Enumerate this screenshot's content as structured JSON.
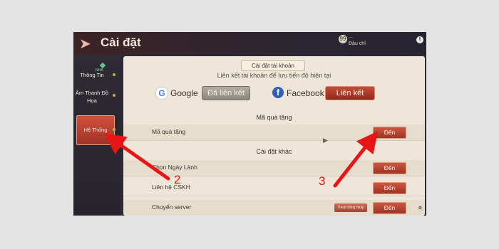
{
  "header": {
    "back_icon": "back-arrow-icon",
    "title": "Cài đặt",
    "level": "99",
    "user_meta": "...",
    "user_name": "Đậu chí"
  },
  "sidebar": {
    "items": [
      {
        "label": "Thông Tin"
      },
      {
        "label": "Âm Thanh Đồ Họa"
      },
      {
        "label": "Hệ Thống",
        "active": true
      }
    ],
    "gem_label": "NHA"
  },
  "account": {
    "section_title": "Cài đặt tài khoản",
    "description": "Liên kết tài khoản để lưu tiến độ hiện tại",
    "google": {
      "logo": "G",
      "label": "Google",
      "button": "Đã liên kết"
    },
    "facebook": {
      "logo": "f",
      "label": "Facebook",
      "button": "Liên kết"
    }
  },
  "gift": {
    "section_title": "Mã quà tặng",
    "rows": [
      {
        "label": "Mã quà tặng",
        "button": "Đến"
      }
    ]
  },
  "other": {
    "section_title": "Cài đặt khác",
    "rows": [
      {
        "label": "Chọn Ngày Lành",
        "button": "Đến"
      },
      {
        "label": "Liên hệ CSKH",
        "button": "Đến"
      },
      {
        "label": "Chuyển server",
        "button": "Đến",
        "extra_button": "Thoát đăng nhập"
      }
    ]
  },
  "annotations": {
    "step2": "2",
    "step3": "3"
  },
  "colors": {
    "accent": "#b8402f",
    "panel": "#eee6d9",
    "annotation": "#e81515"
  }
}
